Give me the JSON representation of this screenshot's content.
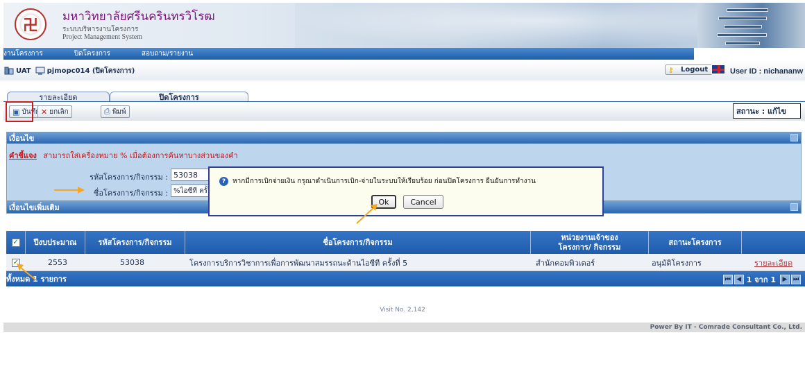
{
  "header": {
    "logo_glyph": "卍",
    "university_name": "มหาวิทยาลัยศรีนครินทรวิโรฒ",
    "system_name_th": "ระบบบริหารงานโครงการ",
    "system_name_en": "Project Management System"
  },
  "menu": {
    "items": [
      "งานโครงการ",
      "ปิดโครงการ",
      "สอบถาม/รายงาน"
    ]
  },
  "env": {
    "label": "UAT",
    "page": "pjmopc014 (ปิดโครงการ)",
    "logout_label": "Logout",
    "user_id_label": "User ID : nichananw"
  },
  "tabs": [
    {
      "label": "รายละเอียด"
    },
    {
      "label": "ปิดโครงการ"
    }
  ],
  "toolbar": {
    "save_label": "บันทึก",
    "cancel_label": "ยกเลิก",
    "print_label": "พิมพ์",
    "status_label": "สถานะ : แก้ไข"
  },
  "conditions": {
    "title": "เงื่อนไข",
    "note_key": "คำชี้แจง",
    "note_text": "สามารถใส่เครื่องหมาย % เมื่อต้องการค้นหาบางส่วนของคำ",
    "project_code_label": "รหัสโครงการ/กิจกรรม :",
    "project_code_value": "53038",
    "project_name_label": "ชื่อโครงการ/กิจกรรม :",
    "project_name_value": "%ไอซีที ครั้ง"
  },
  "more_conditions": {
    "title": "เงื่อนไขเพิ่มเติม"
  },
  "grid": {
    "columns": [
      "ปีงบประมาณ",
      "รหัสโครงการ/กิจกรรม",
      "ชื่อโครงการ/กิจกรรม",
      "หน่วยงานเจ้าของโครงการ/ กิจกรรม",
      "สถานะโครงการ"
    ],
    "rows": [
      {
        "year": "2553",
        "code": "53038",
        "name": "โครงการบริการวิชาการเพื่อการพัฒนาสมรรถนะด้านไอซีที ครั้งที่ 5",
        "owner": "สำนักคอมพิวเตอร์",
        "status": "อนุมัติโครงการ",
        "link": "รายละเอียด"
      }
    ],
    "total_label": "ทั้งหมด 1 รายการ",
    "page_label": "1 จาก 1"
  },
  "dialog": {
    "message": "หากมีการเบิกจ่ายเงิน กรุณาดำเนินการเบิก-จ่ายในระบบให้เรียบร้อย ก่อนปิดโครงการ ยืนยันการทำงาน",
    "ok_label": "Ok",
    "cancel_label": "Cancel"
  },
  "footer": {
    "visit": "Visit No. 2,142",
    "powered": "Power By IT - Comrade Consultant Co., Ltd."
  },
  "colors": {
    "header_blue": "#1f5ea9",
    "annotation_red": "#c81e1e",
    "annotation_arrow": "#f5a623"
  }
}
